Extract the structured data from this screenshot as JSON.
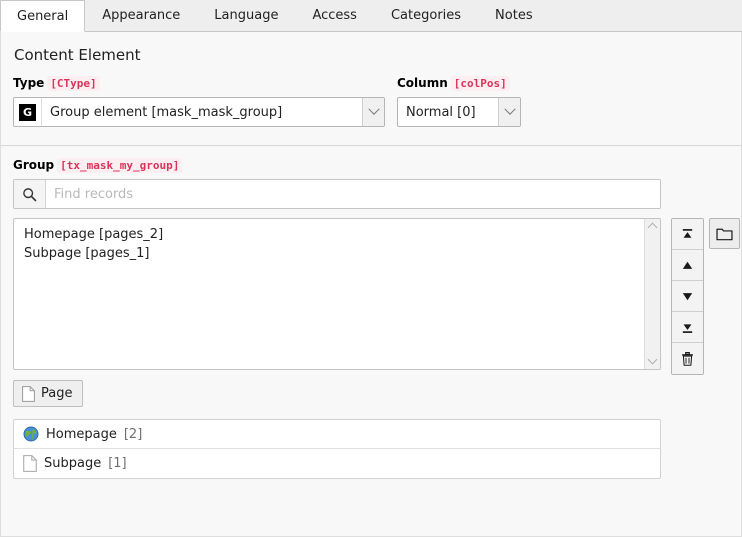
{
  "tabs": [
    {
      "label": "General",
      "active": true
    },
    {
      "label": "Appearance",
      "active": false
    },
    {
      "label": "Language",
      "active": false
    },
    {
      "label": "Access",
      "active": false
    },
    {
      "label": "Categories",
      "active": false
    },
    {
      "label": "Notes",
      "active": false
    }
  ],
  "content_element": {
    "section_title": "Content Element",
    "type_field": {
      "label": "Type",
      "code": "[CType]",
      "icon_badge": "G",
      "icon_name": "group-element-icon",
      "value": "Group element [mask_mask_group]"
    },
    "column_field": {
      "label": "Column",
      "code": "[colPos]",
      "value": "Normal [0]"
    }
  },
  "group_section": {
    "label": "Group",
    "code": "[tx_mask_my_group]",
    "search": {
      "placeholder": "Find records",
      "value": "",
      "icon_name": "search-icon"
    },
    "selected_items": [
      "Homepage [pages_2]",
      "Subpage [pages_1]"
    ],
    "side_buttons": [
      {
        "name": "move-to-top-button",
        "title": "Move to top"
      },
      {
        "name": "move-up-button",
        "title": "Move up"
      },
      {
        "name": "move-down-button",
        "title": "Move down"
      },
      {
        "name": "move-to-bottom-button",
        "title": "Move to bottom"
      },
      {
        "name": "delete-button",
        "title": "Remove selected"
      }
    ],
    "browse_button": {
      "name": "browse-records-button",
      "title": "Browse for records"
    },
    "page_button": {
      "label": "Page",
      "icon_name": "page-icon"
    },
    "results": [
      {
        "title": "Homepage",
        "id": "[2]",
        "icon_name": "globe-icon"
      },
      {
        "title": "Subpage",
        "id": "[1]",
        "icon_name": "page-icon"
      }
    ]
  },
  "colors": {
    "accent_code": "#d9355b",
    "code_background": "#fdeef2",
    "panel_background": "#f8f8f8",
    "tabbar_background": "#eeeeee",
    "active_tab_background": "#ffffff",
    "border": "#c8c8c8",
    "globe_blue": "#4a90d9",
    "globe_green": "#73b233"
  }
}
